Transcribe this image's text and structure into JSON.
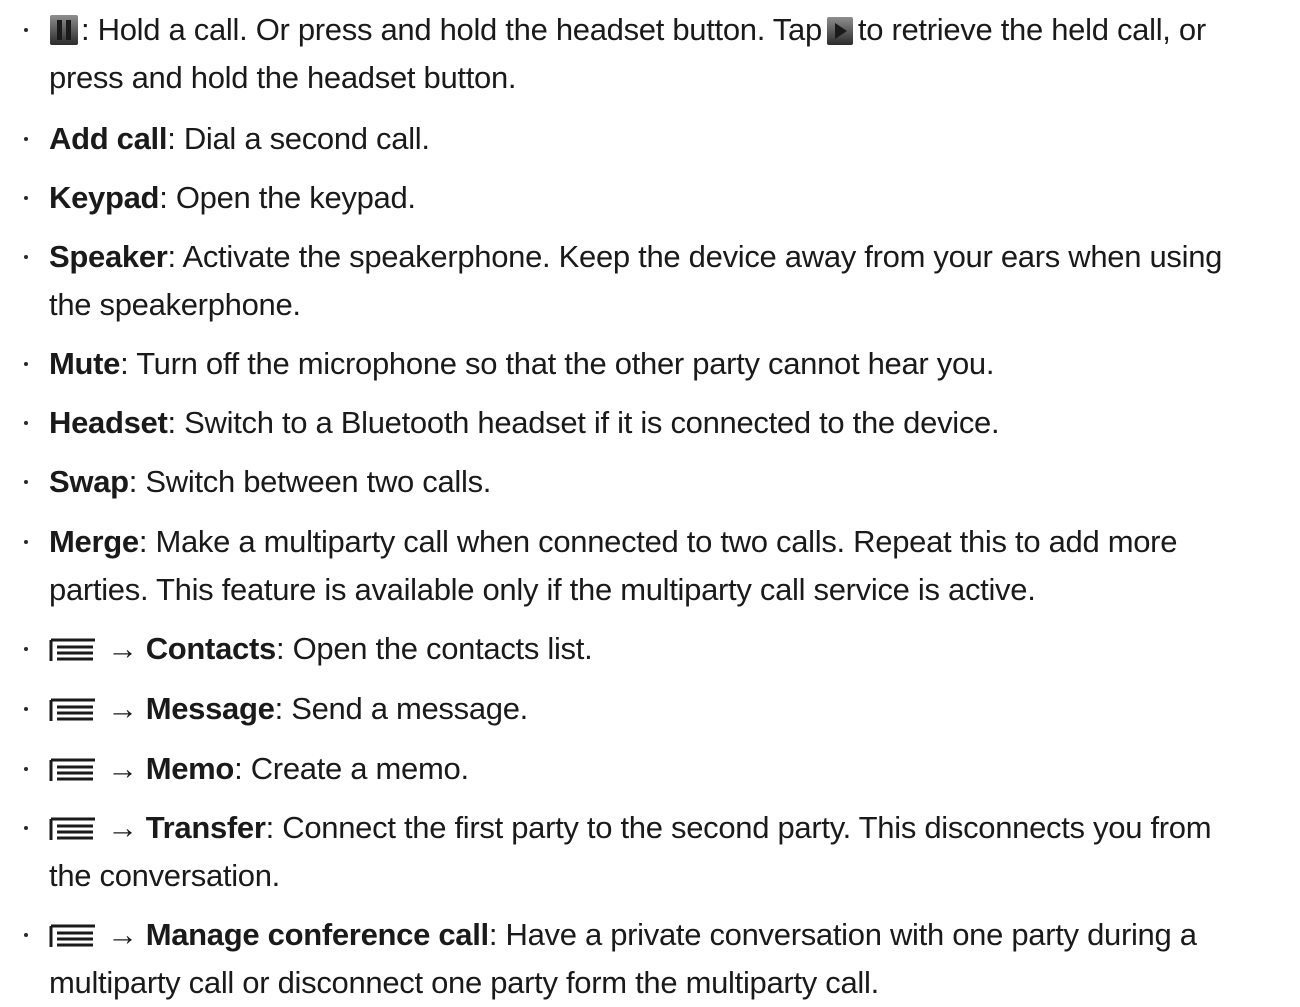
{
  "items": [
    {
      "lines": [
        ": Hold a call. Or press and hold the headset button. Tap",
        "to retrieve the held call, or",
        "press and hold the headset button."
      ]
    },
    {
      "term": "Add call",
      "desc": ": Dial a second call."
    },
    {
      "term": "Keypad",
      "desc": ": Open the keypad."
    },
    {
      "term": "Speaker",
      "desc": ": Activate the speakerphone. Keep the device away from your ears when using",
      "cont": "the speakerphone."
    },
    {
      "term": "Mute",
      "desc": ": Turn off the microphone so that the other party cannot hear you."
    },
    {
      "term": "Headset",
      "desc": ": Switch to a Bluetooth headset if it is connected to the device."
    },
    {
      "term": "Swap",
      "desc": ": Switch between two calls."
    },
    {
      "term": "Merge",
      "desc": ": Make a multiparty call when connected to two calls. Repeat this to add more",
      "cont": "parties. This feature is available only if the multiparty call service is active."
    },
    {
      "arrow": "→",
      "term": "Contacts",
      "desc": ": Open the contacts list."
    },
    {
      "arrow": "→",
      "term": "Message",
      "desc": ": Send a message."
    },
    {
      "arrow": "→",
      "term": "Memo",
      "desc": ": Create a memo."
    },
    {
      "arrow": "→",
      "term": "Transfer",
      "desc": ": Connect the first party to the second party. This disconnects you from",
      "cont": "the conversation."
    },
    {
      "arrow": "→",
      "term": "Manage conference call",
      "desc": ": Have a private conversation with one party during a",
      "cont": "multiparty call or disconnect one party form the multiparty call."
    }
  ],
  "icons": {
    "pause": "pause-icon",
    "play": "play-icon",
    "menu": "menu-icon"
  },
  "colors": {
    "text": "#1a1a1a",
    "icon_dark": "#2b2b2b",
    "icon_gradient_light": "#9a9a9a"
  }
}
